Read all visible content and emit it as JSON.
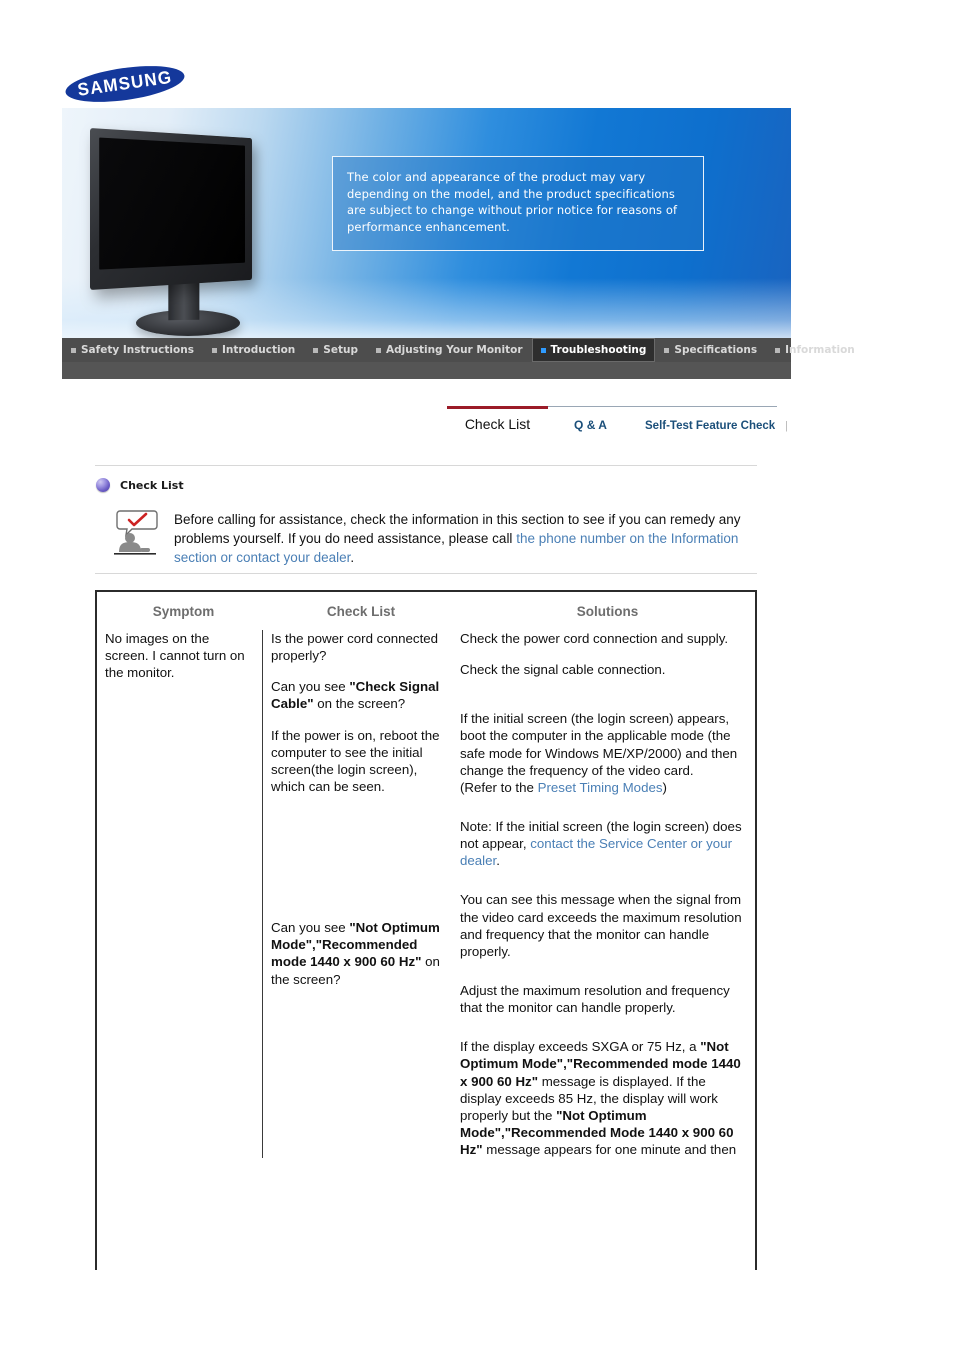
{
  "brand": {
    "logo_text": "SAMSUNG"
  },
  "banner": {
    "notice": "The color and appearance of the product may vary depending on the model, and the product specifications are subject to change without prior notice for reasons of performance enhancement."
  },
  "nav": {
    "items": [
      {
        "label": "Safety Instructions",
        "active": false
      },
      {
        "label": "Introduction",
        "active": false
      },
      {
        "label": "Setup",
        "active": false
      },
      {
        "label": "Adjusting Your Monitor",
        "active": false
      },
      {
        "label": "Troubleshooting",
        "active": true
      },
      {
        "label": "Specifications",
        "active": false
      },
      {
        "label": "Information",
        "active": false
      }
    ]
  },
  "tabs": {
    "items": [
      {
        "label": "Check List",
        "active": true
      },
      {
        "label": "Q & A",
        "active": false
      },
      {
        "label": "Self-Test Feature Check",
        "active": false
      }
    ],
    "divider": "|"
  },
  "section": {
    "title": "Check List",
    "intro_1": "Before calling for assistance, check the information in this section to see if you can remedy any problems yourself. If you do need assistance, please call ",
    "intro_link": "the phone number on the Information section or contact your dealer",
    "intro_end": "."
  },
  "table": {
    "headers": [
      "Symptom",
      "Check List",
      "Solutions"
    ],
    "symptom": "No images on the screen. I cannot turn on the monitor.",
    "checks": {
      "c1": "Is the power cord connected properly?",
      "c2_pre": "Can you see ",
      "c2_bold": "\"Check Signal Cable\"",
      "c2_post": " on the screen?",
      "c3": "If the power is on, reboot the computer to see the initial screen(the login screen), which can be seen.",
      "c4_pre": "Can you see ",
      "c4_bold": "\"Not Optimum Mode\",\"Recommended mode 1440 x 900 60 Hz\"",
      "c4_post": " on the screen?"
    },
    "solutions": {
      "s1": "Check the power cord connection and supply.",
      "s2": "Check the signal cable connection.",
      "s3_a": "If the initial screen (the login screen) appears, boot the computer in the applicable mode (the safe mode for Windows ME/XP/2000) and then change the frequency of the video card.",
      "s3_b_pre": "(Refer to the ",
      "s3_b_link": "Preset Timing Modes",
      "s3_b_post": ")",
      "s4_pre": "Note: If the initial screen (the login screen) does not appear, ",
      "s4_link": "contact the Service Center or your dealer",
      "s4_post": ".",
      "s5": "You can see this message when the signal from the video card exceeds the maximum resolution and frequency that the monitor can handle properly.",
      "s6": "Adjust the maximum resolution and frequency that the monitor can handle properly.",
      "s7_p1": "If the display exceeds SXGA or 75 Hz, a ",
      "s7_b1": "\"Not Optimum Mode\",\"Recommended mode 1440 x 900 60 Hz\"",
      "s7_p2": " message is displayed. If the display exceeds 85 Hz, the display will work properly but the ",
      "s7_b2": "\"Not Optimum Mode\",\"Recommended Mode 1440 x 900 60 Hz\"",
      "s7_p3": " message appears for one minute and then"
    }
  },
  "colors": {
    "brand_blue": "#14389b",
    "banner_blue": "#1278d4",
    "nav_bg": "#4d4d4d",
    "nav_active_bg": "#2e2e2e",
    "nav_active_bullet": "#2f9bff",
    "tab_active_bar": "#9b1b28",
    "link_blue": "#4a7fb5",
    "tab_link": "#1b4f7a"
  }
}
